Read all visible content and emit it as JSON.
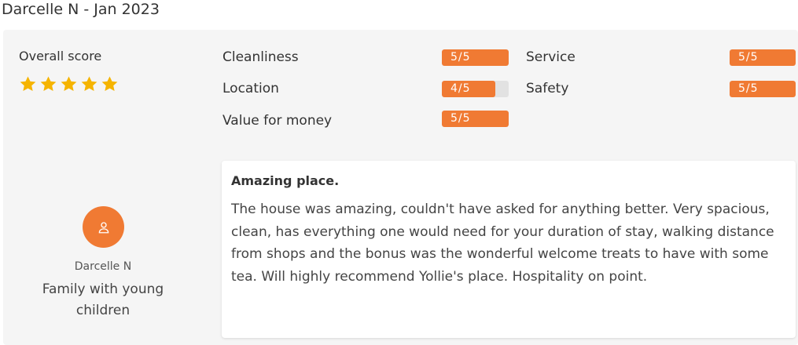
{
  "header": {
    "title": "Darcelle N - Jan 2023"
  },
  "overall": {
    "label": "Overall score",
    "stars": 5,
    "star_color": "#f5b400"
  },
  "ratings": {
    "cleanliness": {
      "label": "Cleanliness",
      "score": 5,
      "max": 5,
      "text": "5/5"
    },
    "location": {
      "label": "Location",
      "score": 4,
      "max": 5,
      "text": "4/5"
    },
    "value": {
      "label": "Value for money",
      "score": 5,
      "max": 5,
      "text": "5/5"
    },
    "service": {
      "label": "Service",
      "score": 5,
      "max": 5,
      "text": "5/5"
    },
    "safety": {
      "label": "Safety",
      "score": 5,
      "max": 5,
      "text": "5/5"
    }
  },
  "accent_color": "#f07a33",
  "reviewer": {
    "name": "Darcelle N",
    "traveler_type": "Family with young children",
    "avatar_icon": "user-icon"
  },
  "review": {
    "title": "Amazing place.",
    "body": "The house was amazing, couldn't have asked for anything better. Very spacious, clean, has everything one would need for your duration of stay, walking distance from shops and the bonus was the wonderful welcome treats to have with some tea. Will highly recommend Yollie's place. Hospitality on point."
  }
}
